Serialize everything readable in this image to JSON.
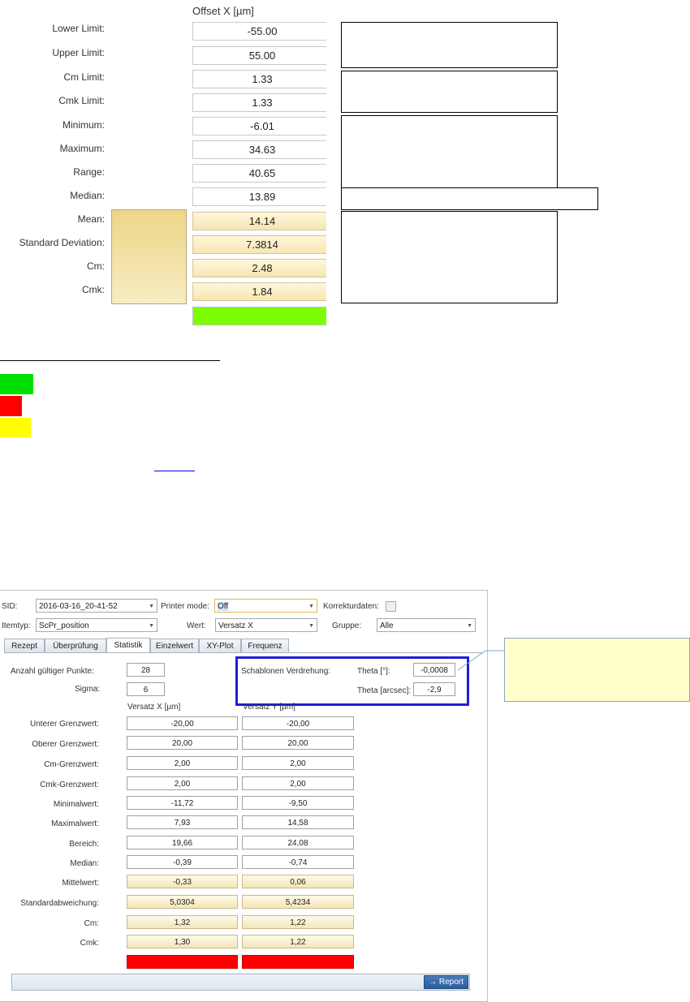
{
  "top_panel": {
    "column_header": "Offset X [µm]",
    "rows": [
      {
        "label": "Lower Limit:",
        "value": "-55.00",
        "highlight": false
      },
      {
        "label": "Upper Limit:",
        "value": "55.00",
        "highlight": false
      },
      {
        "label": "Cm Limit:",
        "value": "1.33",
        "highlight": false
      },
      {
        "label": "Cmk Limit:",
        "value": "1.33",
        "highlight": false
      },
      {
        "label": "Minimum:",
        "value": "-6.01",
        "highlight": false
      },
      {
        "label": "Maximum:",
        "value": "34.63",
        "highlight": false
      },
      {
        "label": "Range:",
        "value": "40.65",
        "highlight": false
      },
      {
        "label": "Median:",
        "value": "13.89",
        "highlight": false
      },
      {
        "label": "Mean:",
        "value": "14.14",
        "highlight": true
      },
      {
        "label": "Standard Deviation:",
        "value": "7.3814",
        "highlight": true
      },
      {
        "label": "Cm:",
        "value": "2.48",
        "highlight": true
      },
      {
        "label": "Cmk:",
        "value": "1.84",
        "highlight": true
      }
    ],
    "status_color": "#7cfc00"
  },
  "legend_swatches": [
    "#00e000",
    "#ff0000",
    "#ffff00"
  ],
  "app": {
    "sid_label": "SID:",
    "sid_value": "2016-03-16_20-41-52",
    "printer_mode_label": "Printer mode:",
    "printer_mode_value": "Off",
    "korrektur_label": "Korrekturdaten:",
    "itemtyp_label": "Itemtyp:",
    "itemtyp_value": "ScPr_position",
    "wert_label": "Wert:",
    "wert_value": "Versatz X",
    "gruppe_label": "Gruppe:",
    "gruppe_value": "Alle",
    "tabs": [
      "Rezept",
      "Überprüfung",
      "Statistik",
      "Einzelwert",
      "XY-Plot",
      "Frequenz"
    ],
    "active_tab": "Statistik",
    "valid_points_label": "Anzahl gültiger Punkte:",
    "valid_points_value": "28",
    "sigma_label": "Sigma:",
    "sigma_value": "6",
    "template_rotation_label": "Schablonen Verdrehung:",
    "theta_deg_label": "Theta [°]:",
    "theta_deg_value": "-0,0008",
    "theta_arcsec_label": "Theta [arcsec]:",
    "theta_arcsec_value": "-2,9",
    "col_x_header": "Versatz X [µm]",
    "col_y_header": "Versatz Y [µm]",
    "rows": [
      {
        "label": "Unterer Grenzwert:",
        "x": "-20,00",
        "y": "-20,00",
        "highlight": false
      },
      {
        "label": "Oberer Grenzwert:",
        "x": "20,00",
        "y": "20,00",
        "highlight": false
      },
      {
        "label": "Cm-Grenzwert:",
        "x": "2,00",
        "y": "2,00",
        "highlight": false
      },
      {
        "label": "Cmk-Grenzwert:",
        "x": "2,00",
        "y": "2,00",
        "highlight": false
      },
      {
        "label": "Minimalwert:",
        "x": "-11,72",
        "y": "-9,50",
        "highlight": false
      },
      {
        "label": "Maximalwert:",
        "x": "7,93",
        "y": "14,58",
        "highlight": false
      },
      {
        "label": "Bereich:",
        "x": "19,66",
        "y": "24,08",
        "highlight": false
      },
      {
        "label": "Median:",
        "x": "-0,39",
        "y": "-0,74",
        "highlight": false
      },
      {
        "label": "Mittelwert:",
        "x": "-0,33",
        "y": "0,06",
        "highlight": true
      },
      {
        "label": "Standardabweichung:",
        "x": "5,0304",
        "y": "5,4234",
        "highlight": true
      },
      {
        "label": "Cm:",
        "x": "1,32",
        "y": "1,22",
        "highlight": true
      },
      {
        "label": "Cmk:",
        "x": "1,30",
        "y": "1,22",
        "highlight": true
      }
    ],
    "status_x_color": "#ff0000",
    "status_y_color": "#ff0000",
    "report_button": "→ Report"
  }
}
